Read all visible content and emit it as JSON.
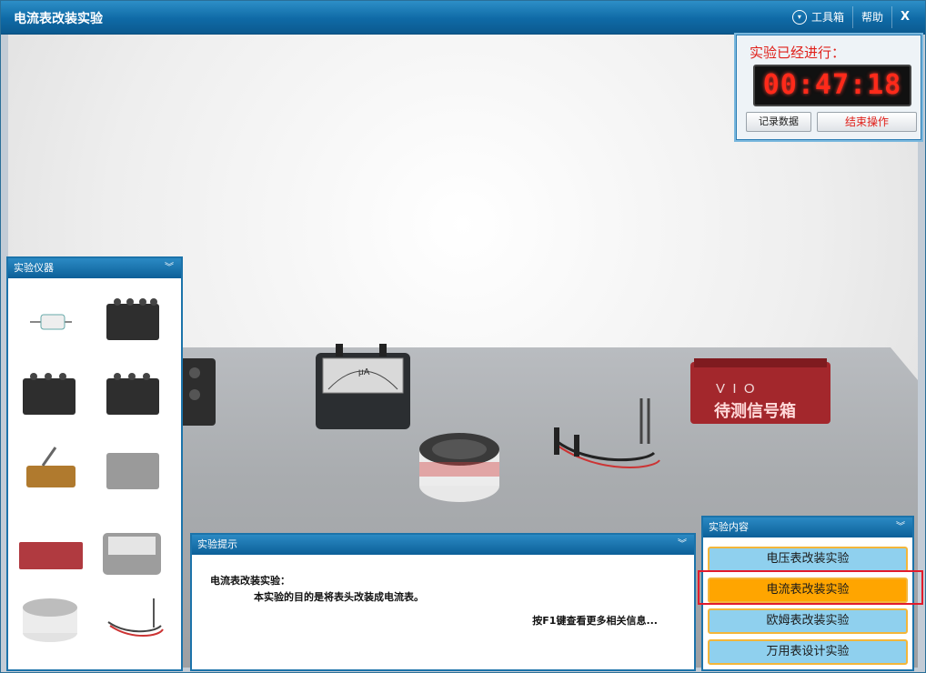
{
  "window": {
    "title": "电流表改装实验"
  },
  "titlebar": {
    "toolbox": "工具箱",
    "help": "帮助",
    "close": "X"
  },
  "timer": {
    "label": "实验已经进行：",
    "time": "00:47:18",
    "record_btn": "记录数据",
    "end_btn": "结束操作"
  },
  "instruments": {
    "title": "实验仪器"
  },
  "hint": {
    "title": "实验提示",
    "line1": "电流表改装实验：",
    "line2": "本实验的目的是将表头改装成电流表。",
    "footer": "按F1键查看更多相关信息..."
  },
  "content": {
    "title": "实验内容",
    "items": [
      "电压表改装实验",
      "电流表改装实验",
      "欧姆表改装实验",
      "万用表设计实验"
    ],
    "active_index": 1
  },
  "scene": {
    "signal_box_label": "待测信号箱",
    "signal_box_terminals": "V  I  O",
    "meter_unit": "μA"
  },
  "colors": {
    "accent": "#0c5f98",
    "active": "#ffa500",
    "timer": "#ff2a1a",
    "highlight": "#e21b2c"
  }
}
